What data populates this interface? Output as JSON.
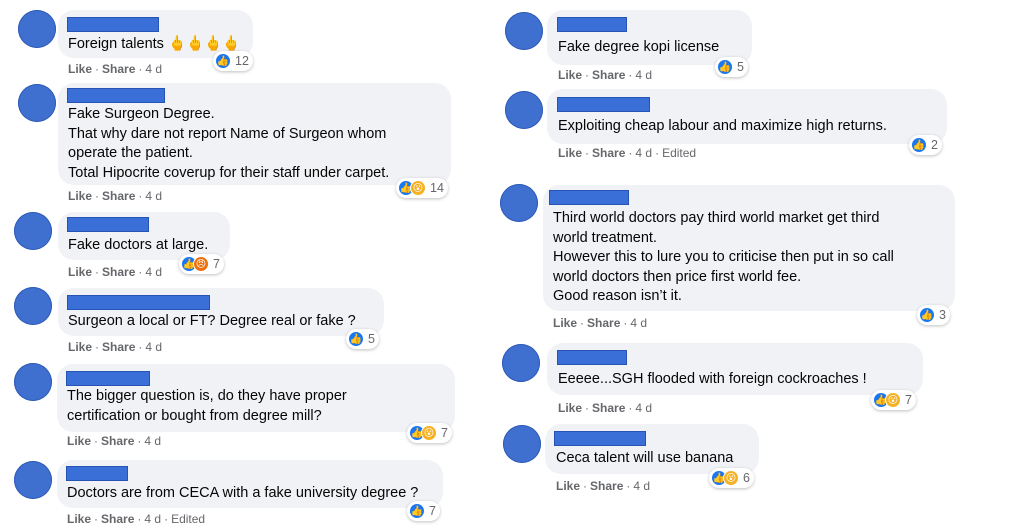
{
  "actions": {
    "like": "Like",
    "share": "Share",
    "dot": "·",
    "edited": "Edited"
  },
  "icons": {
    "like": "thumbs-up-icon",
    "wow": "wow-face-icon",
    "angry": "angry-face-icon"
  },
  "colors": {
    "name_redaction": "#3a6fd8",
    "like_blue": "#1877f2",
    "wow_yellow": "#f7b125"
  },
  "comments": [
    {
      "text": "Foreign talents 🖕🖕🖕🖕",
      "time": "4 d",
      "reaction_count": "12"
    },
    {
      "text": "Fake Surgeon Degree.\nThat why dare not report Name of Surgeon whom\noperate the patient.\nTotal Hipocrite coverup for their staff under carpet.",
      "time": "4 d",
      "reaction_count": "14"
    },
    {
      "text": "Fake doctors at large.",
      "time": "4 d",
      "reaction_count": "7"
    },
    {
      "text": "Surgeon a local or FT? Degree real or fake ?",
      "time": "4 d",
      "reaction_count": "5"
    },
    {
      "text": "The bigger question is, do they have proper\ncertification or bought from degree mill?",
      "time": "4 d",
      "reaction_count": "7"
    },
    {
      "text": "Doctors are from CECA with a fake university degree ?",
      "time": "4 d",
      "edited": "Edited",
      "reaction_count": "7"
    },
    {
      "text": "Fake degree kopi license",
      "time": "4 d",
      "reaction_count": "5"
    },
    {
      "text": "Exploiting cheap labour and maximize high returns.",
      "time": "4 d",
      "edited": "Edited",
      "reaction_count": "2"
    },
    {
      "text": "Third world doctors pay third world market get third\nworld treatment.\nHowever this to lure you to criticise then put in so call\nworld doctors then price first world fee.\nGood reason isn’t it.",
      "time": "4 d",
      "reaction_count": "3"
    },
    {
      "text": "Eeeee...SGH flooded with foreign cockroaches !",
      "time": "4 d",
      "reaction_count": "7"
    },
    {
      "text": "Ceca talent will use banana",
      "time": "4 d",
      "reaction_count": "6"
    }
  ]
}
